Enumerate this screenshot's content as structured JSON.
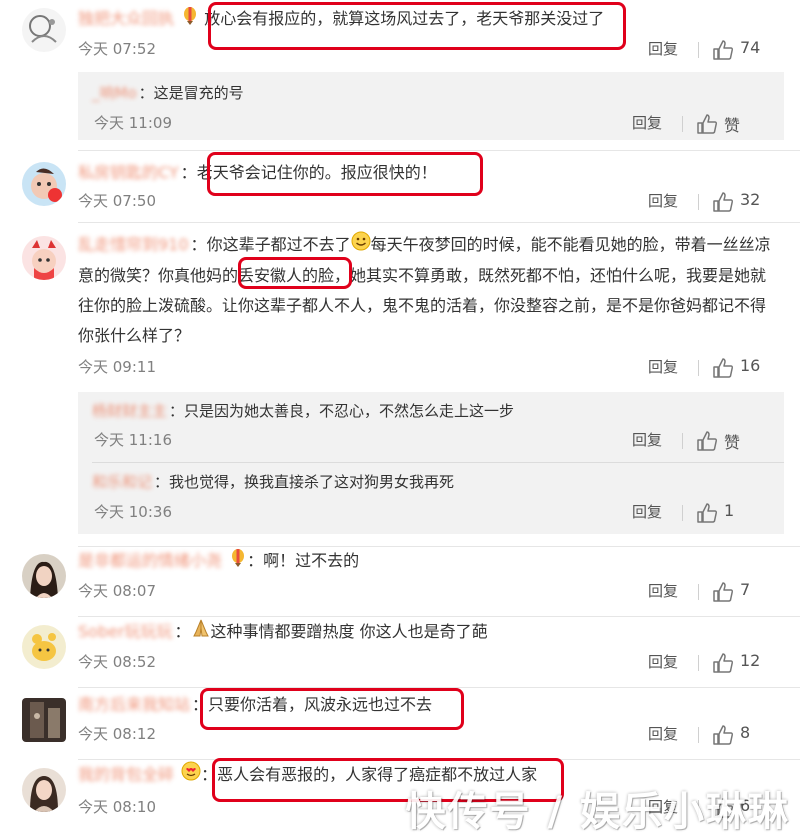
{
  "colors": {
    "name": "#eb7350",
    "highlight": "#e0001b",
    "reply_box_bg": "#f2f2f2"
  },
  "labels": {
    "reply": "回复",
    "zan": "赞"
  },
  "comments": [
    {
      "name": "独把大众回执",
      "text": "放心会有报应的，就算这场风过去了，老天爷那关没过了",
      "time": "今天 07:52",
      "likes": "74",
      "replies": [
        {
          "name": "_响Mo",
          "text": "这是冒充的号",
          "time": "今天 11:09",
          "likes": "赞"
        }
      ]
    },
    {
      "name": "私房钥匙的CY",
      "text": "老天爷会记住你的。报应很快的！",
      "time": "今天 07:50",
      "likes": "32"
    },
    {
      "name": "乱走惜帘到910",
      "text_a": "你这辈子都过不去了",
      "text_b": "每天午夜梦回的时候，能不能看见她的脸，带着一丝丝凉意的微笑？你真他妈的丢安徽人的脸，她其实不算勇敢，既然死都不怕，还怕什么呢，我要是她就往你的脸上泼硫酸。让你这辈子都人不人，鬼不鬼的活着，你没整容之前，是不是你爸妈都记不得你张什么样了？",
      "time": "今天 09:11",
      "likes": "16",
      "replies": [
        {
          "name": "杨财财主主",
          "text": "只是因为她太善良，不忍心，不然怎么走上这一步",
          "time": "今天 11:16",
          "likes": "赞"
        },
        {
          "name": "和乐和记",
          "text": "我也觉得，换我直接杀了这对狗男女我再死",
          "time": "今天 10:36",
          "likes": "1"
        }
      ]
    },
    {
      "name": "是非都运的情绪小尧",
      "text": "啊！过不去的",
      "time": "今天 08:07",
      "likes": "7"
    },
    {
      "name": "Sober玩玩玩",
      "text": "这种事情都要蹭热度 你这人也是奇了葩",
      "time": "今天 08:52",
      "likes": "12"
    },
    {
      "name": "南方后来我知站",
      "text": "只要你活着，风波永远也过不去",
      "time": "今天 08:12",
      "likes": "8"
    },
    {
      "name": "我的背包全碎",
      "text": "恶人会有恶报的，人家得了癌症都不放过人家",
      "time": "今天 08:10",
      "likes": "6"
    }
  ],
  "watermark": "快传号 / 娱乐小琳琳"
}
